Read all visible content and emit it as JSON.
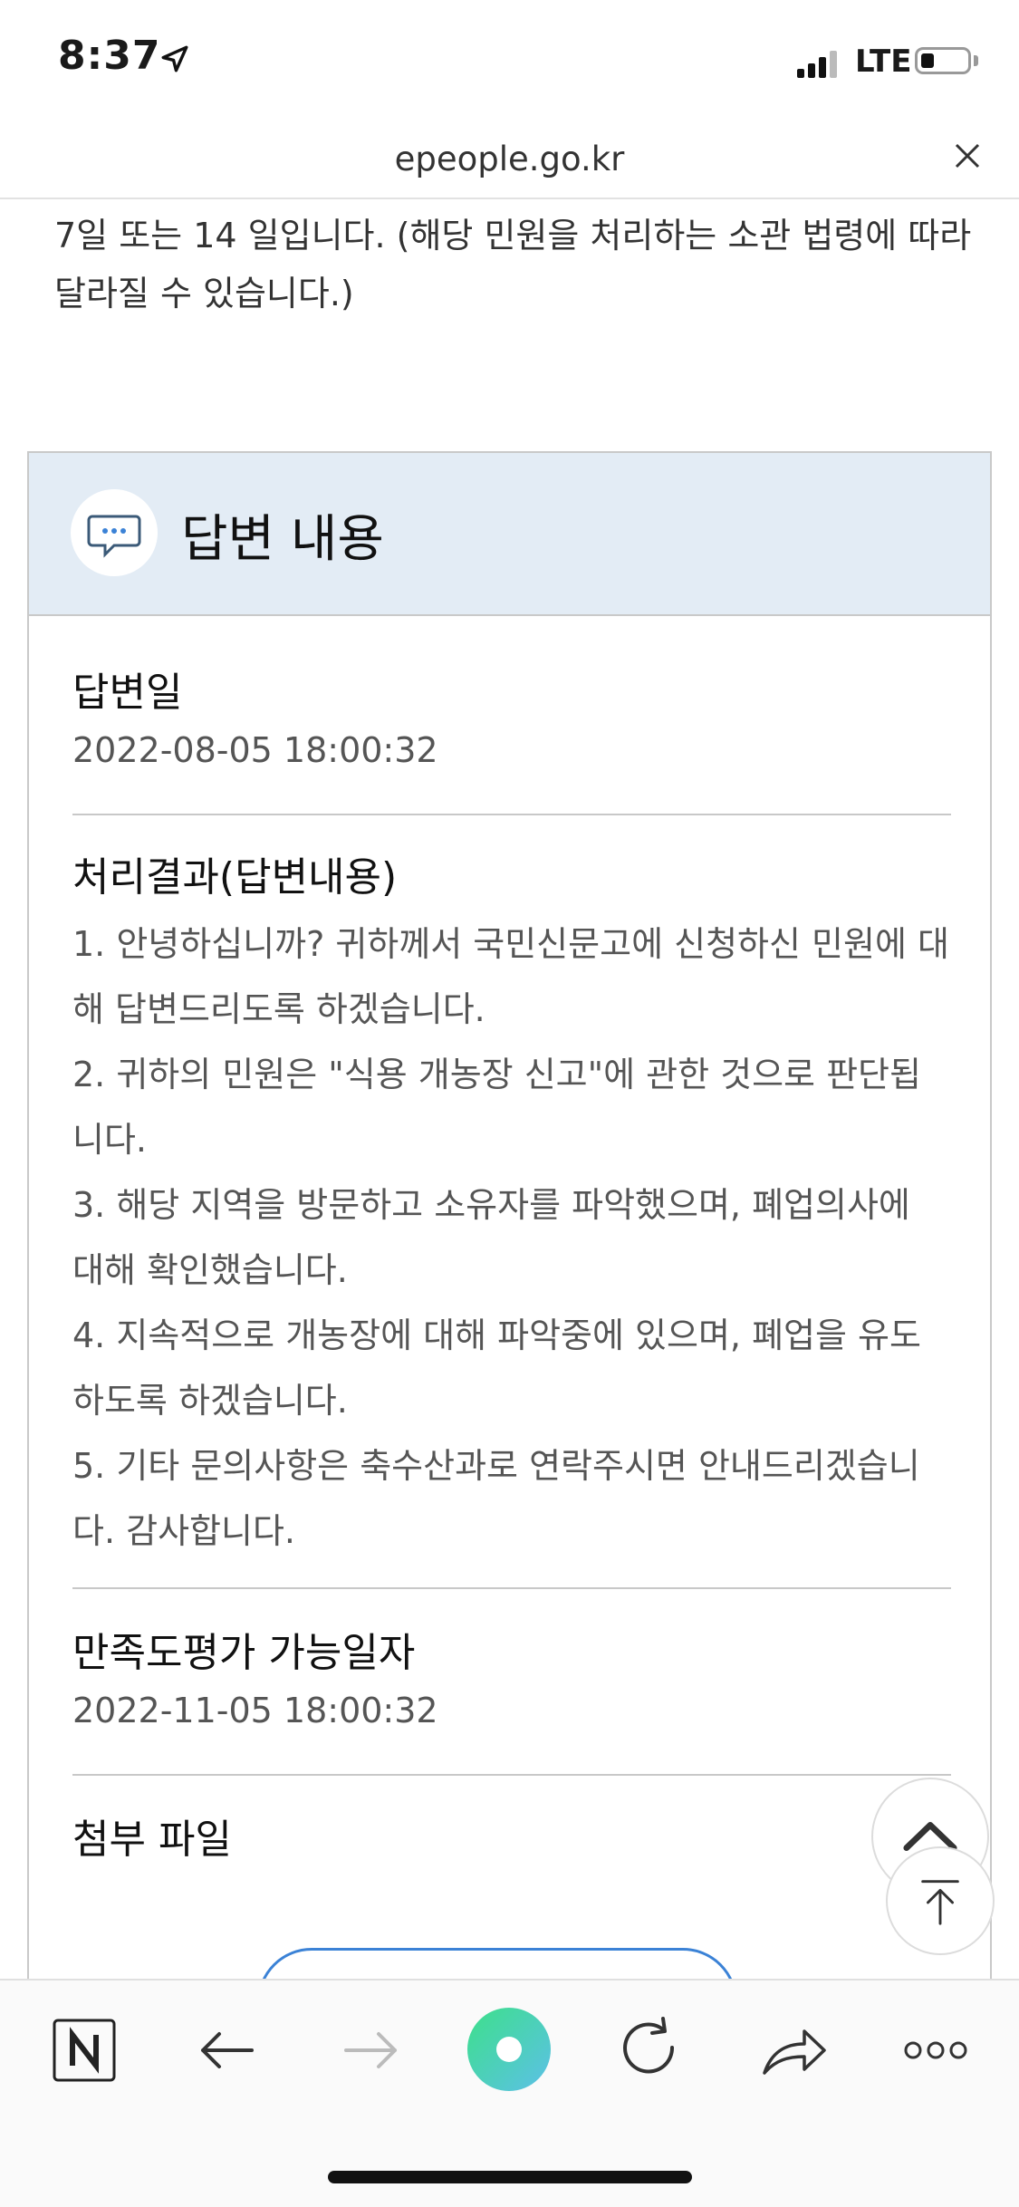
{
  "status_bar": {
    "time": "8:37",
    "network": "LTE",
    "battery_level": 0.3
  },
  "browser": {
    "url": "epeople.go.kr"
  },
  "intro_text": "7일 또는 14 일입니다. (해당 민원을 처리하는 소관 법령에 따라 달라질 수 있습니다.)",
  "panel": {
    "title": "답변 내용",
    "answer_date": {
      "label": "답변일",
      "value": "2022-08-05 18:00:32"
    },
    "result": {
      "label": "처리결과(답변내용)",
      "items": [
        "1. 안녕하십니까? 귀하께서 국민신문고에 신청하신 민원에 대해 답변드리도록 하겠습니다.",
        "2. 귀하의 민원은 \"식용 개농장 신고\"에 관한 것으로 판단됩니다.",
        "3. 해당 지역을 방문하고 소유자를 파악했으며, 폐업의사에 대해 확인했습니다.",
        "4. 지속적으로 개농장에 대해 파악중에 있으며, 폐업을 유도하도록 하겠습니다.",
        "5. 기타 문의사항은 축수산과로 연락주시면 안내드리겠습니다. 감사합니다."
      ]
    },
    "satisfaction_date": {
      "label": "만족도평가 가능일자",
      "value": "2022-11-05 18:00:32"
    },
    "attachment": {
      "label": "첨부 파일"
    }
  },
  "icons": {
    "location": "location-arrow-icon",
    "chat": "chat-bubble-icon",
    "scroll_up": "chevron-up-icon",
    "to_top": "arrow-to-top-icon",
    "naver": "naver-logo-icon",
    "back": "arrow-left-icon",
    "forward": "arrow-right-icon",
    "green_dot": "green-dot-icon",
    "reload": "reload-icon",
    "share": "share-icon",
    "more": "more-dots-icon"
  },
  "colors": {
    "accent": "#3b82d6",
    "header_bg": "#e3ecf5",
    "green_dot": "#4fd69c"
  }
}
